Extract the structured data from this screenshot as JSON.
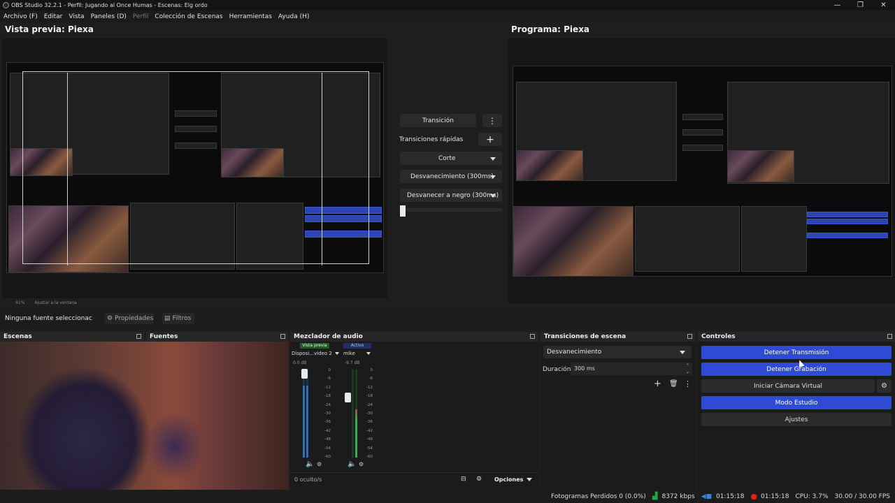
{
  "window": {
    "title": "OBS Studio 32.2.1 - Perfil: Jugando al Once Humas - Escenas: Elg ordo",
    "minimize": "—",
    "maximize": "❐",
    "close": "✕"
  },
  "menu": [
    "Archivo (F)",
    "Editar",
    "Vista",
    "Paneles (D)",
    "Perfil",
    "Colección de Escenas",
    "Herramientas",
    "Ayuda (H)"
  ],
  "preview": {
    "title": "Vista previa: Piexa",
    "zoom": "41%",
    "fit_label": "Ajustar a la ventana"
  },
  "program": {
    "title": "Programa: Piexa"
  },
  "studio_transition": {
    "transition_button": "Transición",
    "quick_label": "Transiciones rápidas",
    "items": [
      "Corte",
      "Desvanecimiento (300ms)",
      "Desvanecer a negro (300ms)"
    ],
    "tbar_position": 0
  },
  "source_toolbar": {
    "selection": "Ninguna fuente seleccionac",
    "properties": "Propiedades",
    "filters": "Filtros"
  },
  "docks": {
    "scenes": "Escenas",
    "sources": "Fuentes",
    "mixer": "Mezclador de audio",
    "transitions": "Transiciones de escena",
    "controls": "Controles"
  },
  "mixer": {
    "preview_tag": "Vista previa",
    "active_tag": "Activo",
    "channels": [
      {
        "name": "Disposi...video 2",
        "db": "0.0 dB",
        "level": 0.82,
        "fader": 0.95
      },
      {
        "name": "mike",
        "db": "-9.7 dB",
        "level": 0.55,
        "fader": 0.68
      }
    ],
    "scale": [
      "0",
      "-6",
      "-12",
      "-18",
      "-24",
      "-30",
      "-36",
      "-42",
      "-48",
      "-54",
      "-60"
    ],
    "hidden": "0 oculto/s",
    "options": "Opciones"
  },
  "transitions": {
    "selected": "Desvanecimiento",
    "duration_label": "Duración",
    "duration_value": "300 ms"
  },
  "controls": {
    "stop_stream": "Detener Transmisión",
    "stop_record": "Detener Grabación",
    "virtual_cam": "Iniciar Cámara Virtual",
    "studio_mode": "Modo Estudio",
    "settings": "Ajustes"
  },
  "status": {
    "dropped": "Fotogramas Perdidos 0 (0.0%)",
    "bitrate": "8372 kbps",
    "stream_time": "01:15:18",
    "rec_time": "01:15:18",
    "cpu": "CPU: 3.7%",
    "fps": "30.00 / 30.00 FPS"
  },
  "colors": {
    "accent_blue": "#2f4bd6",
    "live_green": "#22a83a",
    "rec_red": "#e02020"
  }
}
